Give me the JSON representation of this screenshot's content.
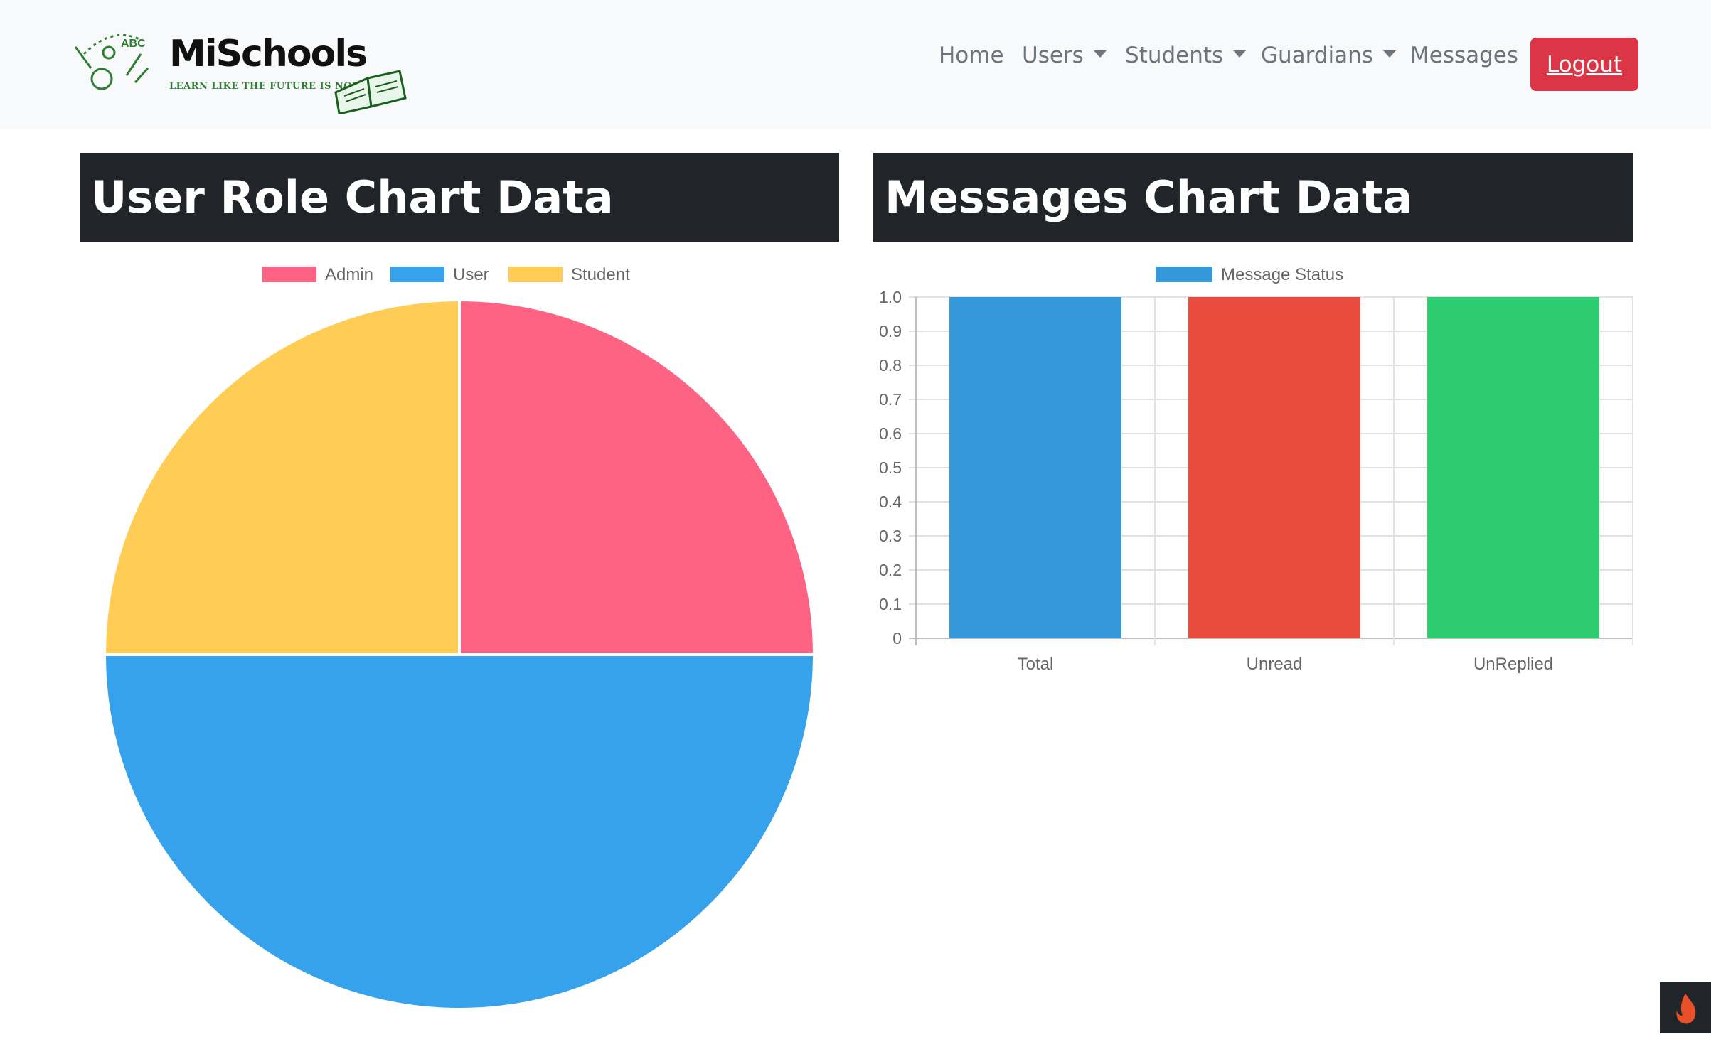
{
  "brand": {
    "name": "MiSchools",
    "tagline": "LEARN LIKE THE FUTURE IS NOW"
  },
  "nav": {
    "home": "Home",
    "users": "Users",
    "students": "Students",
    "guardians": "Guardians",
    "messages": "Messages",
    "logout": "Logout"
  },
  "colors": {
    "navbar_bg": "#f8f9fa",
    "logout_bg": "#dc3545",
    "panel_title_bg": "#212529",
    "admin": "#ff6384",
    "user": "#36a2eb",
    "student": "#ffcd56",
    "total": "#3498db",
    "unread": "#e74c3c",
    "unreplied": "#2ecc71"
  },
  "panels": {
    "user_role_title": "User Role Chart Data",
    "messages_title": "Messages Chart Data"
  },
  "chart_data": [
    {
      "type": "pie",
      "title": "",
      "categories": [
        "Admin",
        "User",
        "Student"
      ],
      "values": [
        1,
        2,
        1
      ],
      "colors": [
        "#ff6384",
        "#36a2eb",
        "#ffcd56"
      ],
      "legend": "top"
    },
    {
      "type": "bar",
      "title": "",
      "categories": [
        "Total",
        "Unread",
        "UnReplied"
      ],
      "series": [
        {
          "name": "Message Status",
          "values": [
            1,
            1,
            1
          ]
        }
      ],
      "colors": [
        "#3498db",
        "#e74c3c",
        "#2ecc71"
      ],
      "ylim": [
        0,
        1
      ],
      "yticks": [
        "0",
        "0.1",
        "0.2",
        "0.3",
        "0.4",
        "0.5",
        "0.6",
        "0.7",
        "0.8",
        "0.9",
        "1.0"
      ],
      "grid": true,
      "legend": "top"
    }
  ]
}
